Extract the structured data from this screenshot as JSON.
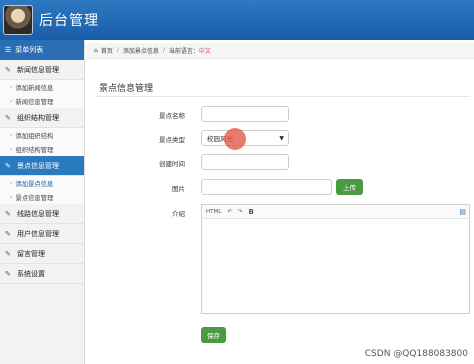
{
  "header": {
    "title": "后台管理"
  },
  "sidebar": {
    "heading": "菜单列表",
    "groups": [
      {
        "label": "新闻信息管理",
        "icon": "edit-icon"
      },
      {
        "label": "组织结构管理",
        "icon": "edit-icon"
      },
      {
        "label": "景点信息管理",
        "icon": "edit-icon"
      },
      {
        "label": "线路信息管理",
        "icon": "edit-icon"
      },
      {
        "label": "用户信息管理",
        "icon": "edit-icon"
      },
      {
        "label": "留言管理",
        "icon": "edit-icon"
      },
      {
        "label": "系统设置",
        "icon": "edit-icon"
      }
    ],
    "subs": {
      "news": [
        "添加新闻信息",
        "新闻信息管理"
      ],
      "org": [
        "添加组织结构",
        "组织结构管理"
      ],
      "scenic": [
        "添加景点信息",
        "景点信息管理"
      ]
    }
  },
  "breadcrumb": {
    "home": "首页",
    "parent": "添加景点信息",
    "lang_label": "当前语言：",
    "lang_value": "中文"
  },
  "form": {
    "title": "景点信息管理",
    "name_label": "景点名称",
    "type_label": "景点类型",
    "type_value": "校园风光",
    "time_label": "创建时间",
    "image_label": "图片",
    "upload_button": "上传",
    "intro_label": "介绍",
    "editor_tools": [
      "HTML",
      "↶",
      "↷",
      "B"
    ],
    "save_button": "保存"
  },
  "watermark": "CSDN @QQ188083800",
  "colors": {
    "header": "#1a5da8",
    "active": "#2a7ac0",
    "button": "#4a9a44"
  }
}
